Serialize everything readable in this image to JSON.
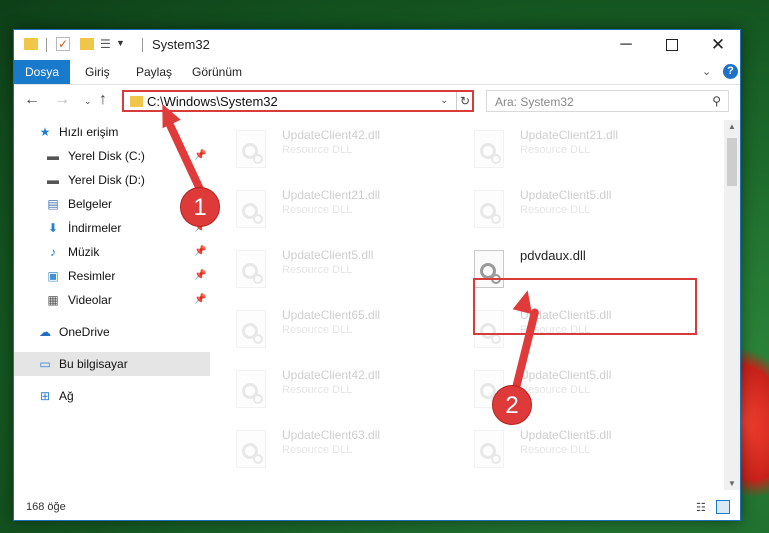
{
  "window": {
    "title": "System32",
    "controls": {
      "minimize": "─",
      "maximize": "",
      "close": "✕"
    }
  },
  "ribbon": {
    "tabs": [
      "Dosya",
      "Giriş",
      "Paylaş",
      "Görünüm"
    ],
    "expand": "⌄",
    "help": "?"
  },
  "navigation": {
    "address": "C:\\Windows\\System32",
    "search_placeholder": "Ara: System32"
  },
  "sidebar": {
    "items": [
      {
        "label": "Hızlı erişim",
        "icon": "star-icon",
        "glyph": "★",
        "color": "#1e7fd6"
      },
      {
        "label": "Yerel Disk (C:)",
        "icon": "drive-icon",
        "glyph": "▬",
        "color": "#555555"
      },
      {
        "label": "Yerel Disk (D:)",
        "icon": "drive-icon",
        "glyph": "▬",
        "color": "#555555"
      },
      {
        "label": "Belgeler",
        "icon": "documents-icon",
        "glyph": "▤",
        "color": "#3f6fb0"
      },
      {
        "label": "İndirmeler",
        "icon": "download-icon",
        "glyph": "⬇",
        "color": "#1e7fd6"
      },
      {
        "label": "Müzik",
        "icon": "music-icon",
        "glyph": "♪",
        "color": "#1e7fd6"
      },
      {
        "label": "Resimler",
        "icon": "pictures-icon",
        "glyph": "▣",
        "color": "#3f8fd6"
      },
      {
        "label": "Videolar",
        "icon": "videos-icon",
        "glyph": "▦",
        "color": "#555555"
      },
      {
        "label": "OneDrive",
        "icon": "cloud-icon",
        "glyph": "☁",
        "color": "#1e6fc2"
      },
      {
        "label": "Bu bilgisayar",
        "icon": "computer-icon",
        "glyph": "▭",
        "color": "#2e7fd0"
      },
      {
        "label": "Ağ",
        "icon": "network-icon",
        "glyph": "⊞",
        "color": "#2e7fd0"
      }
    ]
  },
  "files": [
    {
      "name": "UpdateClient42.dll",
      "type": "Resource DLL"
    },
    {
      "name": "UpdateClient21.dll",
      "type": "Resource DLL"
    },
    {
      "name": "UpdateClient21.dll",
      "type": "Resource DLL"
    },
    {
      "name": "UpdateClient5.dll",
      "type": "Resource DLL"
    },
    {
      "name": "UpdateClient5.dll",
      "type": "Resource DLL"
    },
    {
      "name": "pdvdaux.dll",
      "type": ""
    },
    {
      "name": "UpdateClient65.dll",
      "type": "Resource DLL"
    },
    {
      "name": "UpdateClient5.dll",
      "type": "Resource DLL"
    },
    {
      "name": "UpdateClient42.dll",
      "type": "Resource DLL"
    },
    {
      "name": "UpdateClient5.dll",
      "type": "Resource DLL"
    },
    {
      "name": "UpdateClient63.dll",
      "type": "Resource DLL"
    },
    {
      "name": "UpdateClient5.dll",
      "type": "Resource DLL"
    }
  ],
  "status": {
    "count": "168 öğe"
  },
  "annotations": {
    "step1": "1",
    "step2": "2",
    "color": "#de3a3a"
  }
}
